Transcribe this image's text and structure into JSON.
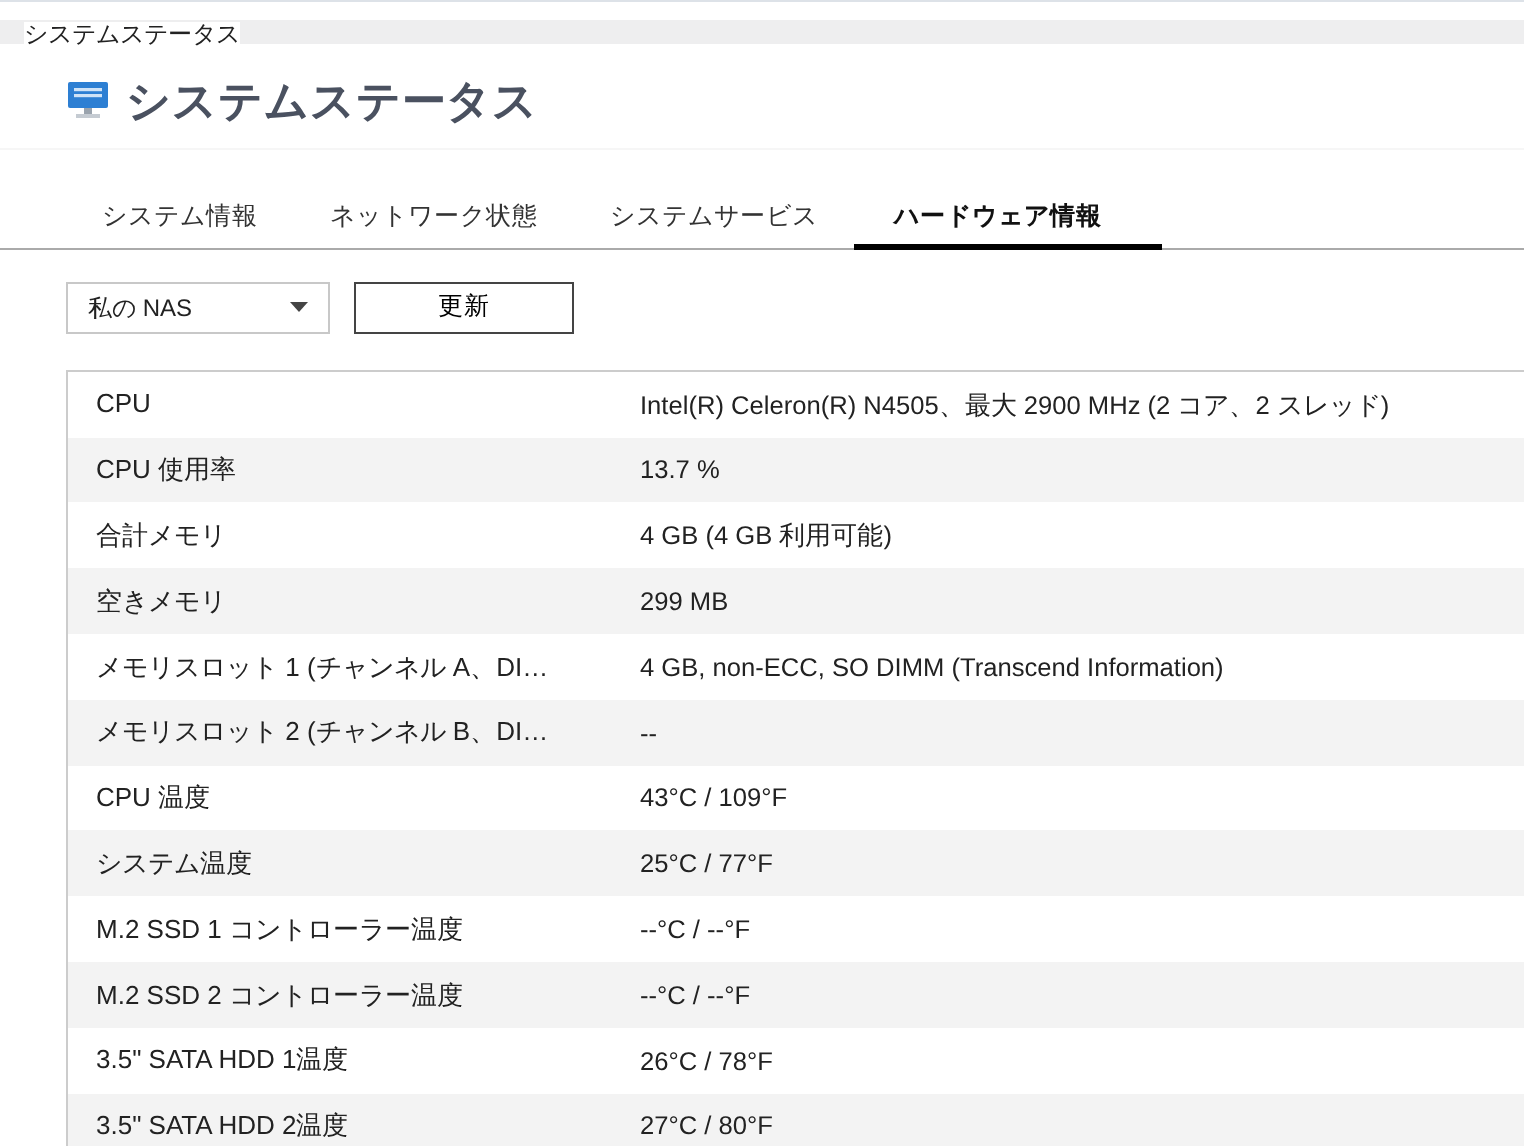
{
  "breadcrumb": "システムステータス",
  "page_title": "システムステータス",
  "tabs": [
    {
      "label": "システム情報",
      "selected": false
    },
    {
      "label": "ネットワーク状態",
      "selected": false
    },
    {
      "label": "システムサービス",
      "selected": false
    },
    {
      "label": "ハードウェア情報",
      "selected": true
    }
  ],
  "device_select": {
    "value": "私の NAS"
  },
  "refresh_button": "更新",
  "table": {
    "rows": [
      {
        "label": "CPU",
        "value": "Intel(R) Celeron(R) N4505、最大 2900 MHz (2 コア、2 スレッド)"
      },
      {
        "label": "CPU 使用率",
        "value": "13.7 %"
      },
      {
        "label": "合計メモリ",
        "value": "4 GB (4 GB 利用可能)"
      },
      {
        "label": "空きメモリ",
        "value": "299 MB"
      },
      {
        "label": "メモリスロット 1 (チャンネル A、DI…",
        "value": "4 GB, non-ECC, SO DIMM (Transcend Information)"
      },
      {
        "label": "メモリスロット 2 (チャンネル B、DI…",
        "value": "--"
      },
      {
        "label": "CPU 温度",
        "value": "43°C / 109°F"
      },
      {
        "label": "システム温度",
        "value": "25°C / 77°F"
      },
      {
        "label": "M.2 SSD 1 コントローラー温度",
        "value": "--°C / --°F"
      },
      {
        "label": "M.2 SSD 2 コントローラー温度",
        "value": "--°C / --°F"
      },
      {
        "label": "3.5\" SATA HDD 1温度",
        "value": "26°C / 78°F"
      },
      {
        "label": "3.5\" SATA HDD 2温度",
        "value": "27°C / 80°F"
      }
    ]
  }
}
